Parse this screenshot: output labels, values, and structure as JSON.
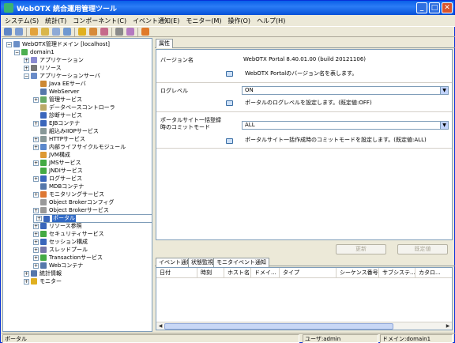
{
  "window": {
    "title": "WebOTX 統合運用管理ツール"
  },
  "menu": [
    "システム(S)",
    "統計(T)",
    "コンポーネント(C)",
    "イベント通知(E)",
    "モニター(M)",
    "操作(O)",
    "ヘルプ(H)"
  ],
  "tree": [
    {
      "label": "WebOTX管理ドメイン [localhost]",
      "icon": "domain-root-icon",
      "color": "#6b8fc7"
    },
    {
      "label": "domain1",
      "icon": "domain-icon",
      "color": "#4caf50"
    },
    {
      "label": "アプリケーション",
      "icon": "application-icon",
      "color": "#8a8ad0"
    },
    {
      "label": "リソース",
      "icon": "resource-icon",
      "color": "#777777"
    },
    {
      "label": "アプリケーションサーバ",
      "icon": "app-server-icon",
      "color": "#6a8cc8"
    },
    {
      "label": "Java EEサーバ",
      "icon": "javaee-icon",
      "color": "#cc8833"
    },
    {
      "label": "WebServer",
      "icon": "webserver-icon",
      "color": "#5577aa"
    },
    {
      "label": "管理サービス",
      "icon": "admin-service-icon",
      "color": "#66aa66"
    },
    {
      "label": "データベースコントローラ",
      "icon": "db-controller-icon",
      "color": "#bbaa66"
    },
    {
      "label": "診断サービス",
      "icon": "diagnostic-icon",
      "color": "#3a66bb"
    },
    {
      "label": "EJBコンテナ",
      "icon": "ejb-container-icon",
      "color": "#3a66bb"
    },
    {
      "label": "組込みIIOPサービス",
      "icon": "iiop-icon",
      "color": "#889999"
    },
    {
      "label": "HTTPサービス",
      "icon": "http-service-icon",
      "color": "#889999"
    },
    {
      "label": "内部ライフサイクルモジュール",
      "icon": "lifecycle-icon",
      "color": "#5a88cc"
    },
    {
      "label": "JVM構成",
      "icon": "jvm-icon",
      "color": "#dd9933"
    },
    {
      "label": "JMSサービス",
      "icon": "jms-icon",
      "color": "#44aa44"
    },
    {
      "label": "JNDIサービス",
      "icon": "jndi-icon",
      "color": "#44aa44"
    },
    {
      "label": "ログサービス",
      "icon": "log-service-icon",
      "color": "#3a66bb"
    },
    {
      "label": "MDBコンテナ",
      "icon": "mdb-container-icon",
      "color": "#5577aa"
    },
    {
      "label": "モニタリングサービス",
      "icon": "monitoring-icon",
      "color": "#dd7733"
    },
    {
      "label": "Object Brokerコンフィグ",
      "icon": "ob-config-icon",
      "color": "#999999"
    },
    {
      "label": "Object Brokerサービス",
      "icon": "ob-service-icon",
      "color": "#999999"
    },
    {
      "label": "ポータル",
      "icon": "portal-icon",
      "color": "#3a66bb"
    },
    {
      "label": "リソース参照",
      "icon": "resource-ref-icon",
      "color": "#3a66bb"
    },
    {
      "label": "セキュリティサービス",
      "icon": "security-icon",
      "color": "#44aa44"
    },
    {
      "label": "セッション構成",
      "icon": "session-icon",
      "color": "#3a66bb"
    },
    {
      "label": "スレッドプール",
      "icon": "thread-pool-icon",
      "color": "#7777aa"
    },
    {
      "label": "Transactionサービス",
      "icon": "transaction-icon",
      "color": "#44aa44"
    },
    {
      "label": "Webコンテナ",
      "icon": "web-container-icon",
      "color": "#5577aa"
    },
    {
      "label": "統計情報",
      "icon": "statistics-icon",
      "color": "#5577aa"
    },
    {
      "label": "モニター",
      "icon": "monitor-icon",
      "color": "#e0b020"
    }
  ],
  "props": {
    "tab": "属性",
    "rows": [
      {
        "label": "バージョン名",
        "value": "WebOTX Portal 8.40.01.00 (build 20121106)",
        "desc": "WebOTX Portalのバージョン名を表します。"
      },
      {
        "label": "ログレベル",
        "value": "ON",
        "desc": "ポータルのログレベルを設定します。(既定値:OFF)"
      },
      {
        "label_line1": "ポータルサイト一括登録",
        "label_line2": "時のコミットモード",
        "value": "ALL",
        "desc": "ポータルサイト一括作成時のコミットモードを設定します。(既定値:ALL)"
      }
    ],
    "update_button": "更新",
    "default_button": "既定値"
  },
  "events": {
    "tabs": [
      "イベント通知",
      "状態監視",
      "モニタイベント通知"
    ],
    "columns": [
      "日付",
      "時刻",
      "ホスト名",
      "ドメイ...",
      "タイプ",
      "シーケンス番号",
      "サブシステ...",
      "カタロ..."
    ]
  },
  "status": {
    "left": "ポータル",
    "user": "ユーザ:admin",
    "domain": "ドメイン:domain1"
  }
}
